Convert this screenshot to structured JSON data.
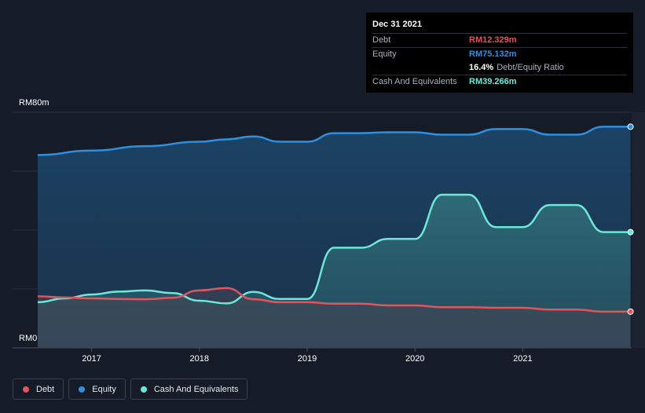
{
  "tooltip": {
    "date": "Dec 31 2021",
    "debt_label": "Debt",
    "debt_value": "RM12.329m",
    "equity_label": "Equity",
    "equity_value": "RM75.132m",
    "ratio_value": "16.4%",
    "ratio_label": "Debt/Equity Ratio",
    "cash_label": "Cash And Equivalents",
    "cash_value": "RM39.266m"
  },
  "colors": {
    "debt": "#e5535d",
    "equity": "#2f8fdf",
    "cash": "#6ee7d8"
  },
  "legend": [
    {
      "name": "debt-legend",
      "label": "Debt",
      "color": "#e5535d"
    },
    {
      "name": "equity-legend",
      "label": "Equity",
      "color": "#2f8fdf"
    },
    {
      "name": "cash-legend",
      "label": "Cash And Equivalents",
      "color": "#6ee7d8"
    }
  ],
  "chart_data": {
    "type": "area",
    "ylabel_top": "RM80m",
    "ylabel_bottom": "RM0",
    "ylim": [
      0,
      80
    ],
    "xlim": [
      2016.5,
      2022.0
    ],
    "x_ticks": [
      "2017",
      "2018",
      "2019",
      "2020",
      "2021"
    ],
    "grid": true,
    "legend_position": "bottom-left",
    "series": [
      {
        "name": "Equity",
        "key": "equity",
        "x": [
          2016.5,
          2017.0,
          2017.5,
          2018.0,
          2018.25,
          2018.5,
          2018.75,
          2019.0,
          2019.25,
          2019.5,
          2019.75,
          2020.0,
          2020.25,
          2020.5,
          2020.75,
          2021.0,
          2021.25,
          2021.5,
          2021.75,
          2022.0
        ],
        "y": [
          65.5,
          67.0,
          68.5,
          70.0,
          70.8,
          71.8,
          70.0,
          70.0,
          72.9,
          72.9,
          73.2,
          73.2,
          72.4,
          72.4,
          74.3,
          74.3,
          72.4,
          72.4,
          75.1,
          75.1
        ]
      },
      {
        "name": "Cash And Equivalents",
        "key": "cash",
        "x": [
          2016.5,
          2016.75,
          2017.0,
          2017.25,
          2017.5,
          2017.75,
          2018.0,
          2018.25,
          2018.5,
          2018.75,
          2019.0,
          2019.25,
          2019.5,
          2019.75,
          2020.0,
          2020.25,
          2020.5,
          2020.75,
          2021.0,
          2021.25,
          2021.5,
          2021.75,
          2022.0
        ],
        "y": [
          15.5,
          16.8,
          18.1,
          19.1,
          19.5,
          18.6,
          16.0,
          15.1,
          19.0,
          16.6,
          16.6,
          34.0,
          34.0,
          37.0,
          37.0,
          52.0,
          52.0,
          41.0,
          41.0,
          48.5,
          48.5,
          39.3,
          39.3
        ]
      },
      {
        "name": "Debt",
        "key": "debt",
        "x": [
          2016.5,
          2016.75,
          2017.0,
          2017.25,
          2017.5,
          2017.75,
          2018.0,
          2018.25,
          2018.5,
          2018.75,
          2019.0,
          2019.25,
          2019.5,
          2019.75,
          2020.0,
          2020.25,
          2020.5,
          2020.75,
          2021.0,
          2021.25,
          2021.5,
          2021.75,
          2022.0
        ],
        "y": [
          17.5,
          17.1,
          16.8,
          16.6,
          16.5,
          17.0,
          19.5,
          20.3,
          16.5,
          15.5,
          15.5,
          15.0,
          15.0,
          14.4,
          14.4,
          13.8,
          13.8,
          13.6,
          13.6,
          13.0,
          13.0,
          12.3,
          12.3
        ]
      }
    ]
  }
}
